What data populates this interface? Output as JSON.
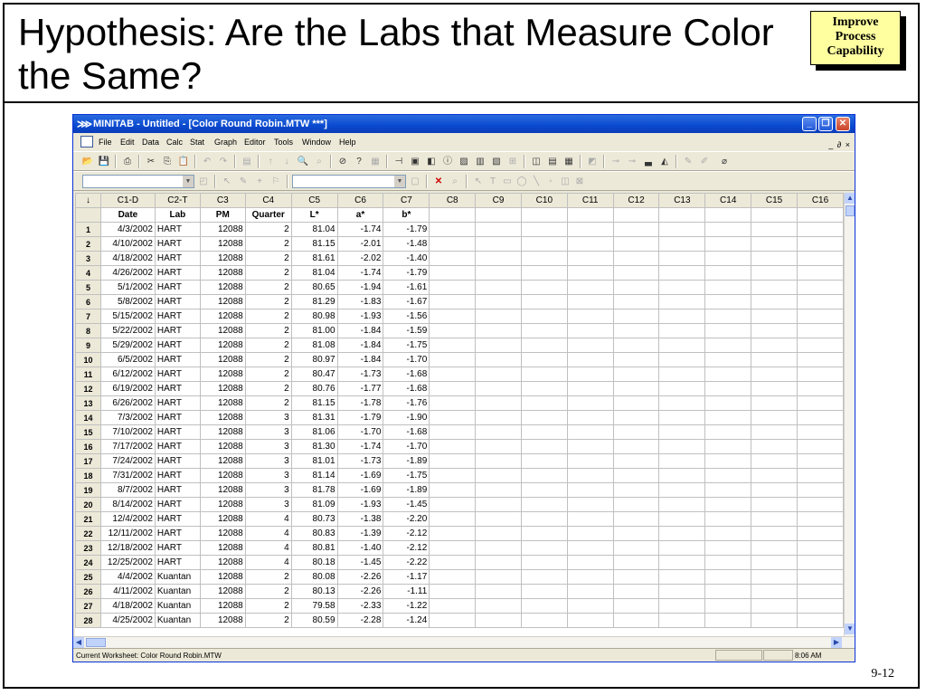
{
  "slide": {
    "title": "Hypothesis: Are the Labs that Measure Color the Same?",
    "badge": [
      "Improve",
      "Process",
      "Capability"
    ],
    "page_number": "9-12"
  },
  "window": {
    "app_icon": "minitab-logo-icon",
    "title": "MINITAB - Untitled - [Color Round Robin.MTW ***]",
    "menu": [
      "File",
      "Edit",
      "Data",
      "Calc",
      "Stat",
      "Graph",
      "Editor",
      "Tools",
      "Window",
      "Help"
    ],
    "mdi_controls": "_ ∂ ×",
    "status_text": "Current Worksheet: Color Round Robin.MTW",
    "time": "8:06 AM"
  },
  "sheet": {
    "corner_arrow": "↓",
    "column_ids": [
      "C1-D",
      "C2-T",
      "C3",
      "C4",
      "C5",
      "C6",
      "C7",
      "C8",
      "C9",
      "C10",
      "C11",
      "C12",
      "C13",
      "C14",
      "C15",
      "C16"
    ],
    "column_names": [
      "Date",
      "Lab",
      "PM",
      "Quarter",
      "L*",
      "a*",
      "b*",
      "",
      "",
      "",
      "",
      "",
      "",
      "",
      "",
      ""
    ],
    "rows": [
      [
        "1",
        "4/3/2002",
        "HART",
        "12088",
        "2",
        "81.04",
        "-1.74",
        "-1.79"
      ],
      [
        "2",
        "4/10/2002",
        "HART",
        "12088",
        "2",
        "81.15",
        "-2.01",
        "-1.48"
      ],
      [
        "3",
        "4/18/2002",
        "HART",
        "12088",
        "2",
        "81.61",
        "-2.02",
        "-1.40"
      ],
      [
        "4",
        "4/26/2002",
        "HART",
        "12088",
        "2",
        "81.04",
        "-1.74",
        "-1.79"
      ],
      [
        "5",
        "5/1/2002",
        "HART",
        "12088",
        "2",
        "80.65",
        "-1.94",
        "-1.61"
      ],
      [
        "6",
        "5/8/2002",
        "HART",
        "12088",
        "2",
        "81.29",
        "-1.83",
        "-1.67"
      ],
      [
        "7",
        "5/15/2002",
        "HART",
        "12088",
        "2",
        "80.98",
        "-1.93",
        "-1.56"
      ],
      [
        "8",
        "5/22/2002",
        "HART",
        "12088",
        "2",
        "81.00",
        "-1.84",
        "-1.59"
      ],
      [
        "9",
        "5/29/2002",
        "HART",
        "12088",
        "2",
        "81.08",
        "-1.84",
        "-1.75"
      ],
      [
        "10",
        "6/5/2002",
        "HART",
        "12088",
        "2",
        "80.97",
        "-1.84",
        "-1.70"
      ],
      [
        "11",
        "6/12/2002",
        "HART",
        "12088",
        "2",
        "80.47",
        "-1.73",
        "-1.68"
      ],
      [
        "12",
        "6/19/2002",
        "HART",
        "12088",
        "2",
        "80.76",
        "-1.77",
        "-1.68"
      ],
      [
        "13",
        "6/26/2002",
        "HART",
        "12088",
        "2",
        "81.15",
        "-1.78",
        "-1.76"
      ],
      [
        "14",
        "7/3/2002",
        "HART",
        "12088",
        "3",
        "81.31",
        "-1.79",
        "-1.90"
      ],
      [
        "15",
        "7/10/2002",
        "HART",
        "12088",
        "3",
        "81.06",
        "-1.70",
        "-1.68"
      ],
      [
        "16",
        "7/17/2002",
        "HART",
        "12088",
        "3",
        "81.30",
        "-1.74",
        "-1.70"
      ],
      [
        "17",
        "7/24/2002",
        "HART",
        "12088",
        "3",
        "81.01",
        "-1.73",
        "-1.89"
      ],
      [
        "18",
        "7/31/2002",
        "HART",
        "12088",
        "3",
        "81.14",
        "-1.69",
        "-1.75"
      ],
      [
        "19",
        "8/7/2002",
        "HART",
        "12088",
        "3",
        "81.78",
        "-1.69",
        "-1.89"
      ],
      [
        "20",
        "8/14/2002",
        "HART",
        "12088",
        "3",
        "81.09",
        "-1.93",
        "-1.45"
      ],
      [
        "21",
        "12/4/2002",
        "HART",
        "12088",
        "4",
        "80.73",
        "-1.38",
        "-2.20"
      ],
      [
        "22",
        "12/11/2002",
        "HART",
        "12088",
        "4",
        "80.83",
        "-1.39",
        "-2.12"
      ],
      [
        "23",
        "12/18/2002",
        "HART",
        "12088",
        "4",
        "80.81",
        "-1.40",
        "-2.12"
      ],
      [
        "24",
        "12/25/2002",
        "HART",
        "12088",
        "4",
        "80.18",
        "-1.45",
        "-2.22"
      ],
      [
        "25",
        "4/4/2002",
        "Kuantan",
        "12088",
        "2",
        "80.08",
        "-2.26",
        "-1.17"
      ],
      [
        "26",
        "4/11/2002",
        "Kuantan",
        "12088",
        "2",
        "80.13",
        "-2.26",
        "-1.11"
      ],
      [
        "27",
        "4/18/2002",
        "Kuantan",
        "12088",
        "2",
        "79.58",
        "-2.33",
        "-1.22"
      ],
      [
        "28",
        "4/25/2002",
        "Kuantan",
        "12088",
        "2",
        "80.59",
        "-2.28",
        "-1.24"
      ]
    ]
  },
  "colors": {
    "titlebar": "#0a4ad0",
    "badge_fill": "#ffffa0",
    "chrome": "#ece9d8"
  }
}
